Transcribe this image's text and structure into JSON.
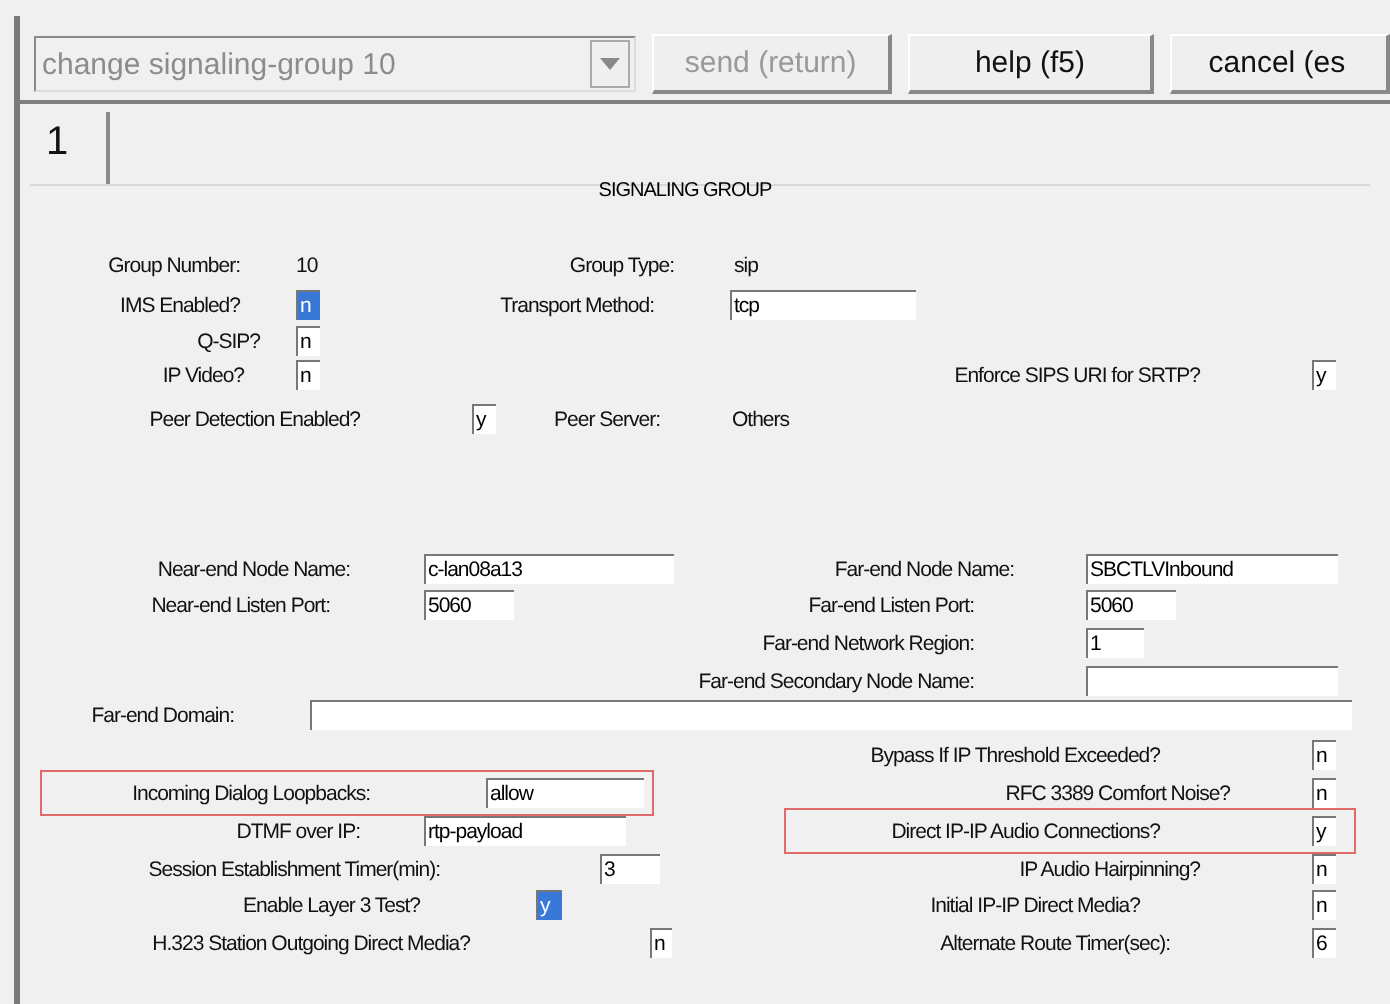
{
  "toolbar": {
    "command": "change signaling-group 10",
    "buttons": [
      {
        "label": "send (return)",
        "disabled": true
      },
      {
        "label": "help (f5)",
        "disabled": false
      },
      {
        "label": "cancel (es",
        "disabled": false
      }
    ]
  },
  "tabs": [
    {
      "label": "1",
      "selected": true
    }
  ],
  "section_title": "SIGNALING GROUP",
  "fields": [
    {
      "label": "Group Number:",
      "kind": "display",
      "value": "10",
      "highlighted": false
    },
    {
      "label": "Group Type:",
      "kind": "display",
      "value": "sip",
      "highlighted": false
    },
    {
      "label": "IMS Enabled?",
      "kind": "input",
      "value": "n",
      "selected": true,
      "highlighted": false
    },
    {
      "label": "Transport Method:",
      "kind": "input",
      "value": "tcp",
      "selected": false,
      "highlighted": false
    },
    {
      "label": "Q-SIP?",
      "kind": "input",
      "value": "n",
      "selected": false,
      "highlighted": false
    },
    {
      "label": "IP Video?",
      "kind": "input",
      "value": "n",
      "selected": false,
      "highlighted": false
    },
    {
      "label": "Enforce SIPS URI for SRTP?",
      "kind": "input",
      "value": "y",
      "selected": false,
      "highlighted": false
    },
    {
      "label": "Peer Detection Enabled?",
      "kind": "input",
      "value": "y",
      "selected": false,
      "highlighted": false
    },
    {
      "label": "Peer Server:",
      "kind": "display",
      "value": "Others",
      "highlighted": false
    },
    {
      "label": "Near-end Node Name:",
      "kind": "input",
      "value": "c-lan08a13",
      "selected": false,
      "highlighted": false
    },
    {
      "label": "Far-end Node Name:",
      "kind": "input",
      "value": "SBCTLVInbound",
      "selected": false,
      "highlighted": false
    },
    {
      "label": "Near-end Listen Port:",
      "kind": "input",
      "value": "5060",
      "selected": false,
      "highlighted": false
    },
    {
      "label": "Far-end Listen Port:",
      "kind": "input",
      "value": "5060",
      "selected": false,
      "highlighted": false
    },
    {
      "label": "Far-end Network Region:",
      "kind": "input",
      "value": "1",
      "selected": false,
      "highlighted": false
    },
    {
      "label": "Far-end Secondary Node Name:",
      "kind": "input",
      "selected": false,
      "highlighted": false
    },
    {
      "label": "Far-end Domain:",
      "kind": "input",
      "selected": false,
      "highlighted": false
    },
    {
      "label": "Bypass If IP Threshold Exceeded?",
      "kind": "input",
      "value": "n",
      "selected": false,
      "highlighted": false
    },
    {
      "label": "Incoming Dialog Loopbacks:",
      "kind": "input",
      "value": "allow",
      "selected": false,
      "highlighted": true
    },
    {
      "label": "RFC 3389 Comfort Noise?",
      "kind": "input",
      "value": "n",
      "selected": false,
      "highlighted": false
    },
    {
      "label": "DTMF over IP:",
      "kind": "input",
      "value": "rtp-payload",
      "selected": false,
      "highlighted": false
    },
    {
      "label": "Direct IP-IP Audio Connections?",
      "kind": "input",
      "value": "y",
      "selected": false,
      "highlighted": true
    },
    {
      "label": "Session Establishment Timer(min):",
      "kind": "input",
      "value": "3",
      "selected": false,
      "highlighted": false
    },
    {
      "label": "IP Audio Hairpinning?",
      "kind": "input",
      "value": "n",
      "selected": false,
      "highlighted": false
    },
    {
      "label": "Enable Layer 3 Test?",
      "kind": "input",
      "value": "y",
      "selected": true,
      "highlighted": false
    },
    {
      "label": "Initial IP-IP Direct Media?",
      "kind": "input",
      "value": "n",
      "selected": false,
      "highlighted": false
    },
    {
      "label": "H.323 Station Outgoing Direct Media?",
      "kind": "input",
      "value": "n",
      "selected": false,
      "highlighted": false
    },
    {
      "label": "Alternate Route Timer(sec):",
      "kind": "input",
      "value": "6",
      "selected": false,
      "highlighted": false
    }
  ]
}
